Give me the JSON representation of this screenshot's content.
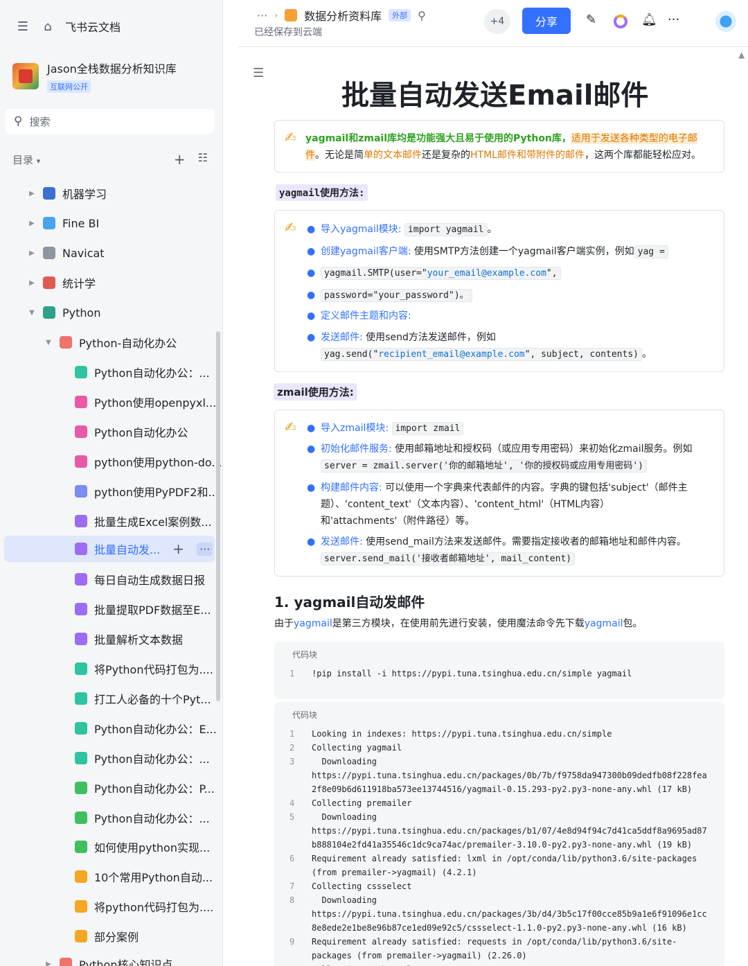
{
  "app": {
    "name": "飞书云文档"
  },
  "knowledge_base": {
    "title": "Jason全栈数据分析知识库",
    "badge": "互联网公开"
  },
  "search": {
    "placeholder": "搜索"
  },
  "toc": {
    "label": "目录"
  },
  "tree": [
    {
      "label": "机器学习",
      "level": 0,
      "arrow": "right",
      "color": "#3d6fd0"
    },
    {
      "label": "Fine BI",
      "level": 0,
      "arrow": "right",
      "color": "#4aa3f0"
    },
    {
      "label": "Navicat",
      "level": 0,
      "arrow": "right",
      "color": "#8f959e"
    },
    {
      "label": "统计学",
      "level": 0,
      "arrow": "right",
      "color": "#e05a4e"
    },
    {
      "label": "Python",
      "level": 0,
      "arrow": "down",
      "color": "#2ea18a"
    },
    {
      "label": "Python-自动化办公",
      "level": 1,
      "arrow": "down",
      "color": "#f0736b"
    },
    {
      "label": "Python自动化办公：...",
      "level": 2,
      "arrow": "",
      "color": "#2ec4a0"
    },
    {
      "label": "Python使用openpyxl...",
      "level": 2,
      "arrow": "",
      "color": "#e85aa7"
    },
    {
      "label": "Python自动化办公",
      "level": 2,
      "arrow": "",
      "color": "#e85aa7"
    },
    {
      "label": "python使用python-do...",
      "level": 2,
      "arrow": "",
      "color": "#e85aa7"
    },
    {
      "label": "python使用PyPDF2和...",
      "level": 2,
      "arrow": "",
      "color": "#7b8cf0"
    },
    {
      "label": "批量生成Excel案例数...",
      "level": 2,
      "arrow": "",
      "color": "#9d6cf5"
    },
    {
      "label": "批量自动发...",
      "level": 2,
      "arrow": "",
      "color": "#9d6cf5",
      "active": true
    },
    {
      "label": "每日自动生成数据日报",
      "level": 2,
      "arrow": "",
      "color": "#9d6cf5"
    },
    {
      "label": "批量提取PDF数据至E...",
      "level": 2,
      "arrow": "",
      "color": "#9d6cf5"
    },
    {
      "label": "批量解析文本数据",
      "level": 2,
      "arrow": "",
      "color": "#9d6cf5"
    },
    {
      "label": "将Python代码打包为....",
      "level": 2,
      "arrow": "",
      "color": "#2ec4a0"
    },
    {
      "label": "打工人必备的十个Pyt...",
      "level": 2,
      "arrow": "",
      "color": "#2ec4a0"
    },
    {
      "label": "Python自动化办公：E...",
      "level": 2,
      "arrow": "",
      "color": "#2ec4a0"
    },
    {
      "label": "Python自动化办公：...",
      "level": 2,
      "arrow": "",
      "color": "#2ec4a0"
    },
    {
      "label": "Python自动化办公：P...",
      "level": 2,
      "arrow": "",
      "color": "#3fbf5f"
    },
    {
      "label": "Python自动化办公：...",
      "level": 2,
      "arrow": "",
      "color": "#3fbf5f"
    },
    {
      "label": "如何使用python实现...",
      "level": 2,
      "arrow": "",
      "color": "#3fbf5f"
    },
    {
      "label": "10个常用Python自动...",
      "level": 2,
      "arrow": "",
      "color": "#f5a623"
    },
    {
      "label": "将python代码打包为....",
      "level": 2,
      "arrow": "",
      "color": "#f5a623"
    },
    {
      "label": "部分案例",
      "level": 2,
      "arrow": "",
      "color": "#f5a623"
    },
    {
      "label": "Python核心知识点",
      "level": 1,
      "arrow": "right",
      "color": "#f0736b"
    }
  ],
  "header": {
    "dots": "···",
    "doc_name": "数据分析资料库",
    "ext_badge": "外部",
    "saved": "已经保存到云端",
    "collab_count": "+4",
    "share": "分享"
  },
  "doc": {
    "title": "批量自动发送Email邮件",
    "callout1": {
      "a": "yagmail和zmail库均是功能强大且易于使用的Python库，",
      "b": "适用于发送各种类型的电子邮件",
      "c": "。无论是简",
      "d": "单的文本邮件",
      "e": "还是复杂的",
      "f": "HTML邮件和带附件的邮件",
      "g": "，这两个库都能轻松应对。"
    },
    "yag_label": "yagmail使用方法:",
    "yag": {
      "b1_k": "导入yagmail模块:",
      "b1_c": "import yagmail",
      "b1_end": "。",
      "b2_k": "创建yagmail客户端:",
      "b2_t": "使用SMTP方法创建一个yagmail客户端实例，例如",
      "b2_c": "yag =",
      "b3_c1": "yagmail.SMTP(user=\"",
      "b3_s": "your_email@example.com",
      "b3_c2": "\",",
      "b4_c": "password=\"your_password\")。",
      "b5_k": "定义邮件主题和内容:",
      "b6_k": "发送邮件:",
      "b6_t": "使用send方法发送邮件，例如",
      "b6_c1": "yag.send(\"",
      "b6_s": "recipient_email@example.com",
      "b6_c2": "\", subject, contents)",
      "b6_end": "。"
    },
    "zm_label": "zmail使用方法:",
    "zm": {
      "b1_k": "导入zmail模块:",
      "b1_c": "import zmail",
      "b2_k": "初始化邮件服务:",
      "b2_t": "使用邮箱地址和授权码（或应用专用密码）来初始化zmail服务。例如",
      "b2_c": "server = zmail.server('你的邮箱地址', '你的授权码或应用专用密码')",
      "b3_k": "构建邮件内容:",
      "b3_t1": "可以使用一个字典来代表邮件的内容。字典的键包括'subject'（邮件主",
      "b3_t2": "题）、'content_text'（文本内容）、'content_html'（HTML内容）",
      "b3_t3": "和'attachments'（附件路径）等。",
      "b4_k": "发送邮件:",
      "b4_t": "使用send_mail方法来发送邮件。需要指定接收者的邮箱地址和邮件内容。",
      "b4_c": "server.send_mail('接收者邮箱地址', mail_content)"
    },
    "h2": "1. yagmail自动发邮件",
    "para": {
      "a": "由于",
      "b": "yagmail",
      "c": "是第三方模块，在使用前先进行安装，使用魔法命令先下载",
      "d": "yagmail",
      "e": "包。"
    },
    "code_label": "代码块",
    "code1": "!pip install -i https://pypi.tuna.tsinghua.edu.cn/simple yagmail",
    "code2": [
      {
        "n": "1",
        "t": "Looking in indexes: https://pypi.tuna.tsinghua.edu.cn/simple"
      },
      {
        "n": "2",
        "t": "Collecting yagmail"
      },
      {
        "n": "3",
        "t": "  Downloading"
      },
      {
        "n": "",
        "t": "https://pypi.tuna.tsinghua.edu.cn/packages/0b/7b/f9758da947300b09dedfb08f228fea"
      },
      {
        "n": "",
        "t": "2f8e09b6d611918ba573ee13744516/yagmail-0.15.293-py2.py3-none-any.whl (17 kB)"
      },
      {
        "n": "4",
        "t": "Collecting premailer"
      },
      {
        "n": "5",
        "t": "  Downloading"
      },
      {
        "n": "",
        "t": "https://pypi.tuna.tsinghua.edu.cn/packages/b1/07/4e8d94f94c7d41ca5ddf8a9695ad87"
      },
      {
        "n": "",
        "t": "b888104e2fd41a35546c1dc9ca74ac/premailer-3.10.0-py2.py3-none-any.whl (19 kB)"
      },
      {
        "n": "6",
        "t": "Requirement already satisfied: lxml in /opt/conda/lib/python3.6/site-packages"
      },
      {
        "n": "",
        "t": "(from premailer->yagmail) (4.2.1)"
      },
      {
        "n": "7",
        "t": "Collecting cssselect"
      },
      {
        "n": "8",
        "t": "  Downloading"
      },
      {
        "n": "",
        "t": "https://pypi.tuna.tsinghua.edu.cn/packages/3b/d4/3b5c17f00cce85b9a1e6f91096e1cc"
      },
      {
        "n": "",
        "t": "8e8ede2e1be8e96b87ce1ed09e92c5/cssselect-1.1.0-py2.py3-none-any.whl (16 kB)"
      },
      {
        "n": "9",
        "t": "Requirement already satisfied: requests in /opt/conda/lib/python3.6/site-"
      },
      {
        "n": "",
        "t": "packages (from premailer->yagmail) (2.26.0)"
      },
      {
        "n": "10",
        "t": "Collecting cachetools"
      }
    ]
  }
}
